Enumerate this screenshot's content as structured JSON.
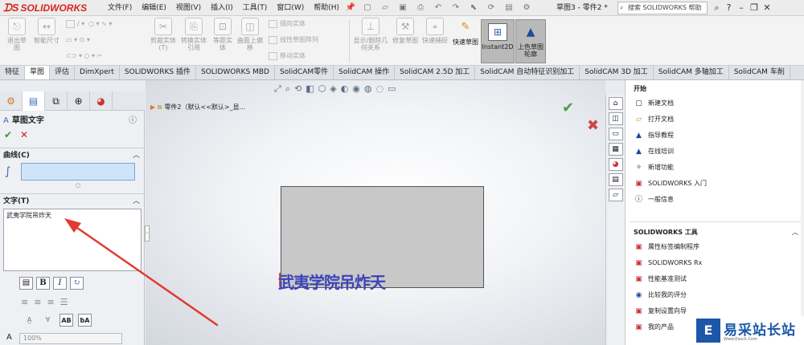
{
  "app": {
    "logo": "SOLIDWORKS",
    "doc_title": "草图3 - 零件2 *"
  },
  "menu": [
    "文件(F)",
    "编辑(E)",
    "视图(V)",
    "插入(I)",
    "工具(T)",
    "窗口(W)",
    "帮助(H)"
  ],
  "help_search": {
    "placeholder": "搜索 SOLIDWORKS 帮助"
  },
  "ribbon": {
    "exit_sketch": "退出草图",
    "smart_dimension": "智能尺寸",
    "cut_entities": "剪裁实体(T)",
    "convert_entities": "转换实体引用",
    "offset_entities": "等距实体",
    "offset_on_surface": "曲面上偏移",
    "mirror_entities": "镜向实体",
    "linear_pattern": "线性草图阵列",
    "move_entities": "移动实体",
    "display_delete_relations": "显示/删除几何关系",
    "repair_sketch": "修复草图",
    "quick_snaps": "快速捕捉",
    "rapid_sketch": "快速草图",
    "instant2d": "Instant2D",
    "shaded_sketch_contours": "上色草图轮廓"
  },
  "tabs": [
    "特征",
    "草图",
    "评估",
    "DimXpert",
    "SOLIDWORKS 插件",
    "SOLIDWORKS MBD",
    "SolidCAM零件",
    "SolidCAM 操作",
    "SolidCAM 2.5D 加工",
    "SolidCAM 自动特征识别加工",
    "SolidCAM 3D 加工",
    "SolidCAM 多轴加工",
    "SolidCAM 车削"
  ],
  "property_manager": {
    "title": "草图文字",
    "curves_label": "曲线(C)",
    "text_label": "文字(T)",
    "text_value": "武夷学院吊炸天",
    "width_value": "100%"
  },
  "tree": {
    "root": "零件2（默认<<默认>_显..."
  },
  "sketch": {
    "text": "武夷学院吊炸天"
  },
  "task_pane": {
    "section1_title": "开始",
    "section1_items": [
      "新建文档",
      "打开文档",
      "指导教程",
      "在线培训",
      "新增功能",
      "SOLIDWORKS 入门",
      "一般信息"
    ],
    "section2_title": "SOLIDWORKS 工具",
    "section2_items": [
      "属性标签编制程序",
      "SOLIDWORKS Rx",
      "性能基准测试",
      "比较我的评分",
      "复制设置向导",
      "我的产品"
    ]
  },
  "watermark": {
    "name": "易采站长站",
    "url": "Www.Easck.Com"
  },
  "colors": {
    "brand_red": "#d9241f",
    "sketch_text": "#3c43b8",
    "annotation_arrow": "#e23b30"
  }
}
